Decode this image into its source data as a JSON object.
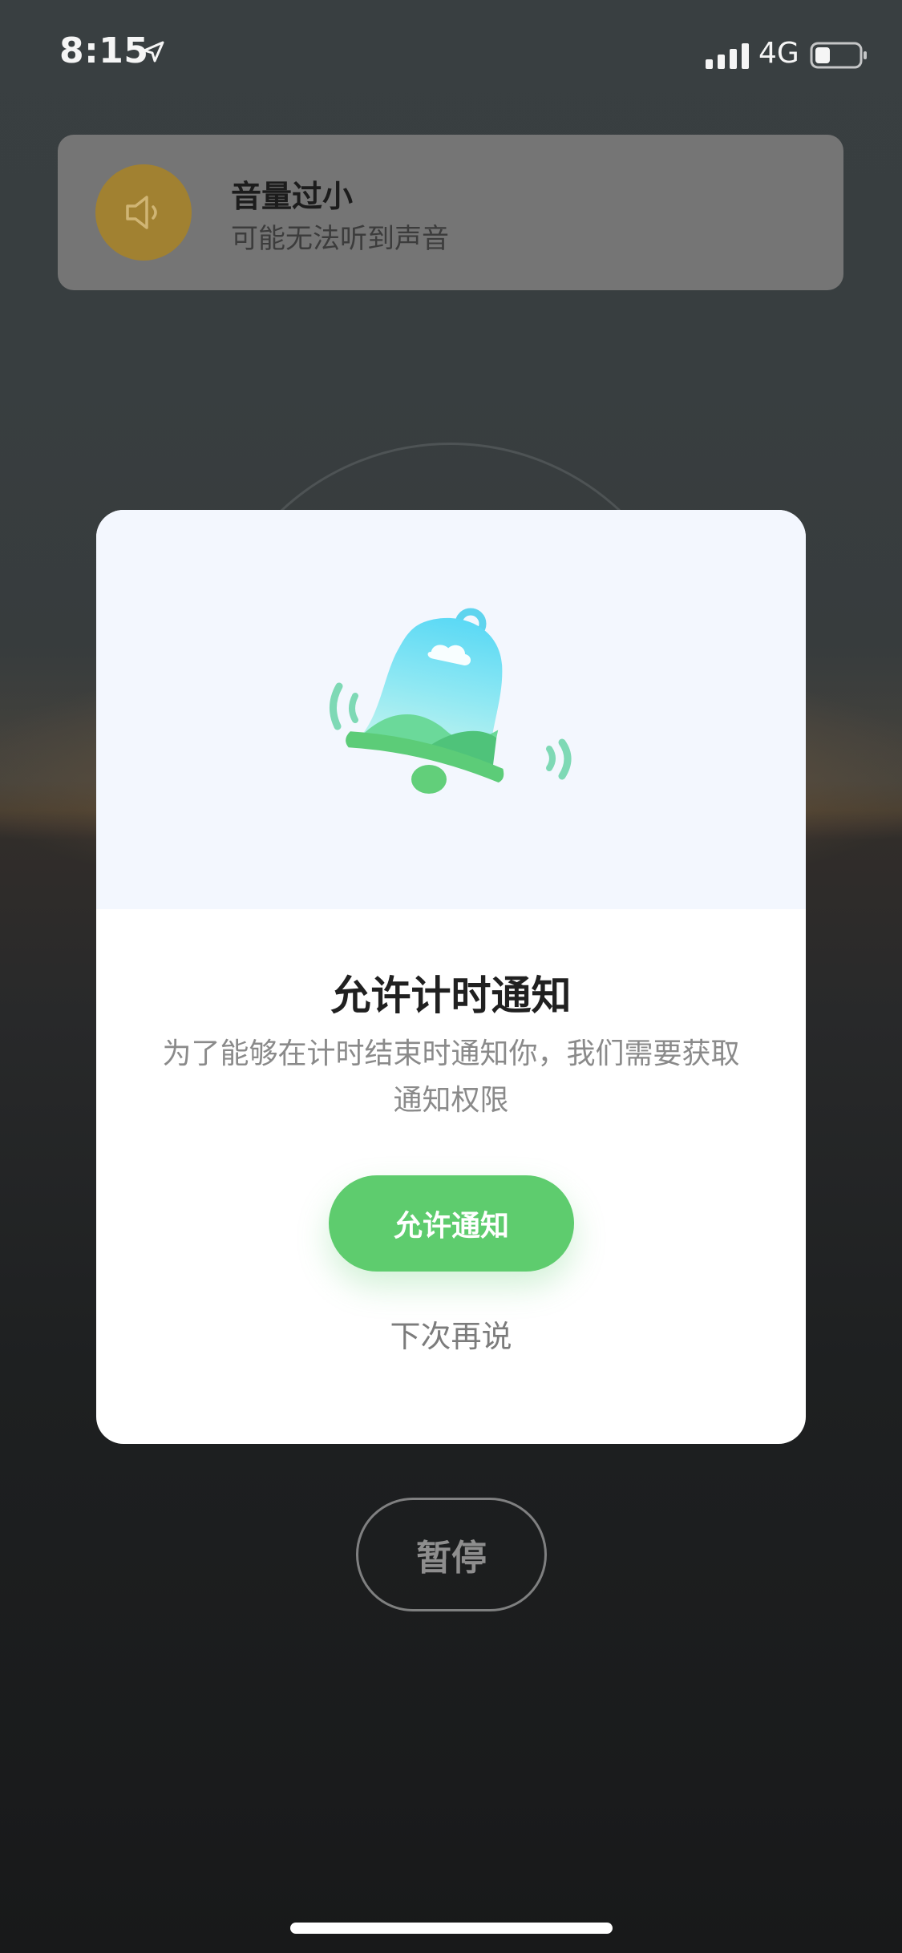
{
  "status_bar": {
    "time": "8:15",
    "network": "4G",
    "location_icon": "location-arrow-icon",
    "signal_icon": "cellular-signal-icon",
    "battery_icon": "battery-icon"
  },
  "volume_toast": {
    "icon": "speaker-icon",
    "title": "音量过小",
    "subtitle": "可能无法听到声音"
  },
  "permission_dialog": {
    "illustration": "bell-icon",
    "title": "允许计时通知",
    "description": "为了能够在计时结束时通知你，我们需要获取通知权限",
    "allow_label": "允许通知",
    "later_label": "下次再说",
    "accent_color": "#5ecc6e"
  },
  "controls": {
    "pause_label": "暂停"
  }
}
